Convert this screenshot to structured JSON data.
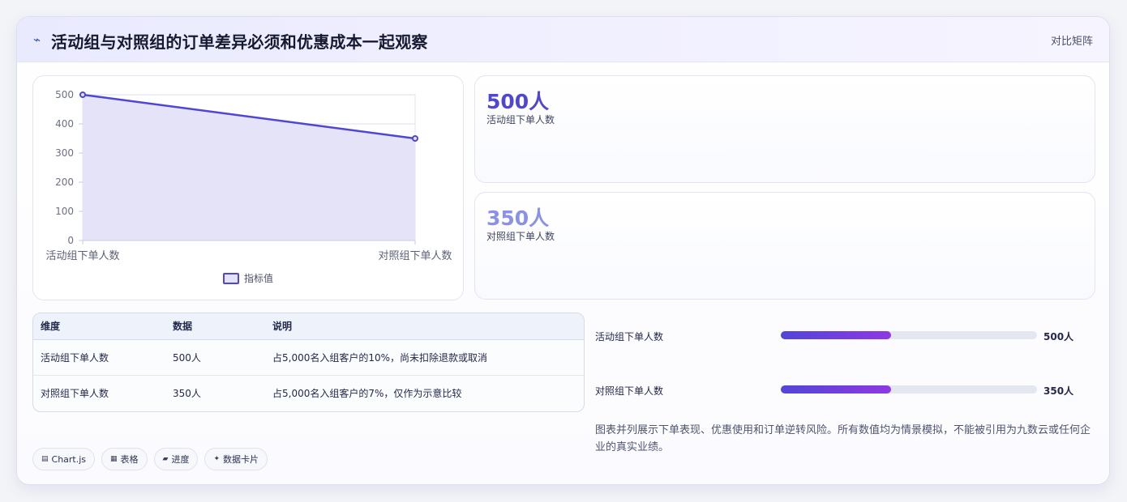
{
  "header": {
    "icon": "trend-icon",
    "title": "活动组与对照组的订单差异必须和优惠成本一起观察",
    "right_label": "对比矩阵"
  },
  "chart_data": {
    "type": "area",
    "categories": [
      "活动组下单人数",
      "对照组下单人数"
    ],
    "series": [
      {
        "name": "指标值",
        "values": [
          500,
          350
        ]
      }
    ],
    "ylim": [
      0,
      500
    ],
    "yticks": [
      0,
      100,
      200,
      300,
      400,
      500
    ],
    "grid": true,
    "legend": "bottom",
    "colors": {
      "line": "#4f46d4",
      "fill": "#e4e2f8"
    }
  },
  "stats": [
    {
      "value": "500人",
      "label": "活动组下单人数",
      "color": "#4f46d4"
    },
    {
      "value": "350人",
      "label": "对照组下单人数",
      "color": "#8a92e8"
    }
  ],
  "table": {
    "headers": [
      "维度",
      "数据",
      "说明"
    ],
    "rows": [
      [
        "活动组下单人数",
        "500人",
        "占5,000名入组客户的10%，尚未扣除退款或取消"
      ],
      [
        "对照组下单人数",
        "350人",
        "占5,000名入组客户的7%，仅作为示意比较"
      ]
    ]
  },
  "progress": [
    {
      "label": "活动组下单人数",
      "value": "500人",
      "fill_fraction": 0.43
    },
    {
      "label": "对照组下单人数",
      "value": "350人",
      "fill_fraction": 0.43
    }
  ],
  "note": "图表并列展示下单表现、优惠使用和订单逆转风险。所有数值均为情景模拟，不能被引用为九数云或任何企业的真实业绩。",
  "tags": [
    {
      "icon": "chart-icon",
      "glyph": "▤",
      "label": "Chart.js"
    },
    {
      "icon": "table-icon",
      "glyph": "▦",
      "label": "表格"
    },
    {
      "icon": "progress-icon",
      "glyph": "▰",
      "label": "进度"
    },
    {
      "icon": "card-icon",
      "glyph": "✦",
      "label": "数据卡片"
    }
  ]
}
